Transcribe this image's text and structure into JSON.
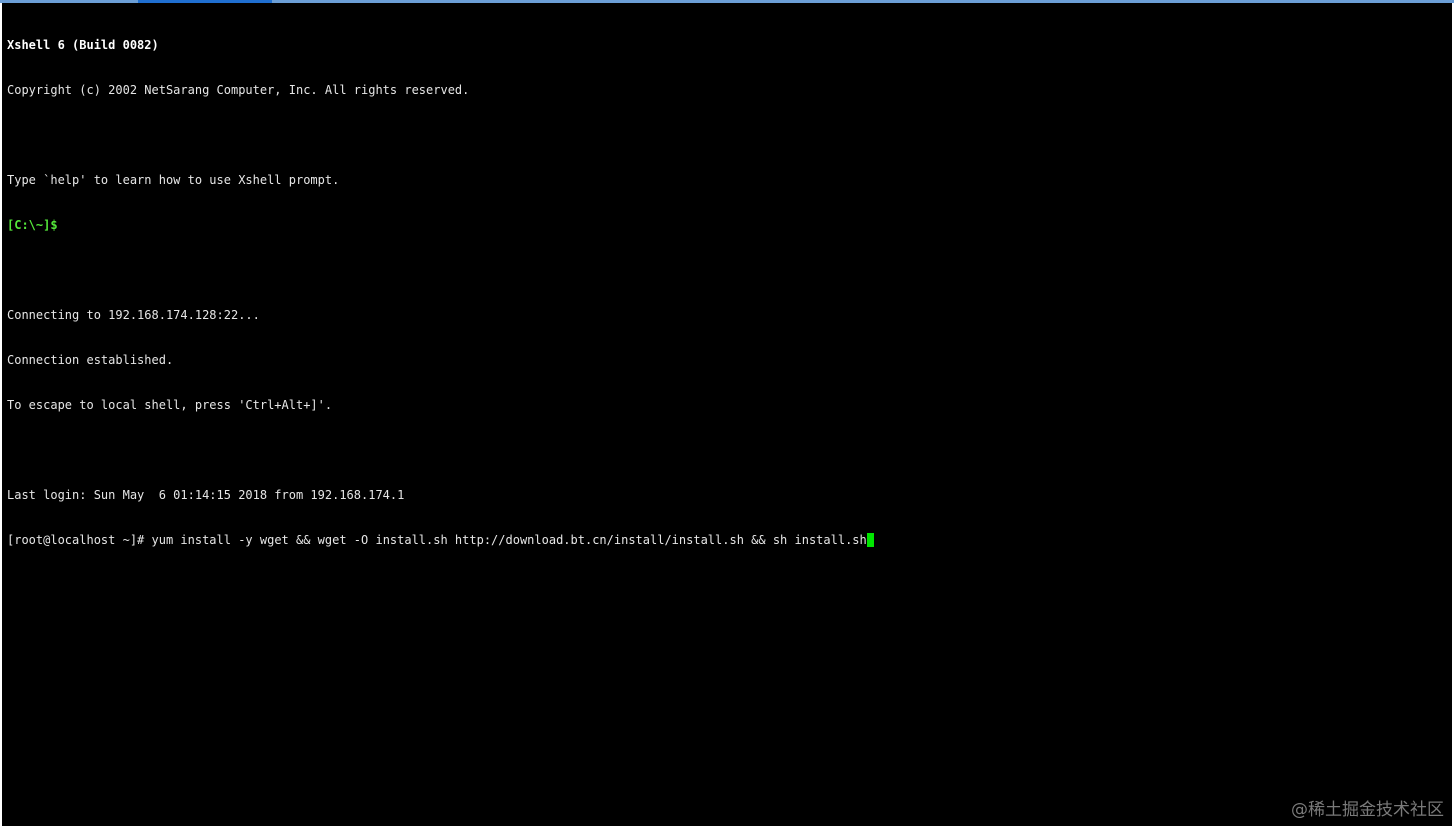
{
  "terminal": {
    "header_title": "Xshell 6 (Build 0082)",
    "copyright": "Copyright (c) 2002 NetSarang Computer, Inc. All rights reserved.",
    "help_hint": "Type `help' to learn how to use Xshell prompt.",
    "local_prompt": "[C:\\~]$",
    "connecting": "Connecting to 192.168.174.128:22...",
    "established": "Connection established.",
    "escape_hint": "To escape to local shell, press 'Ctrl+Alt+]'.",
    "last_login": "Last login: Sun May  6 01:14:15 2018 from 192.168.174.1",
    "remote_prompt": "[root@localhost ~]# ",
    "command": "yum install -y wget && wget -O install.sh http://download.bt.cn/install/install.sh && sh install.sh"
  },
  "watermark": "@稀土掘金技术社区",
  "colors": {
    "background": "#000000",
    "text": "#e6e6e6",
    "prompt_green": "#54e83a",
    "cursor": "#00e600"
  }
}
